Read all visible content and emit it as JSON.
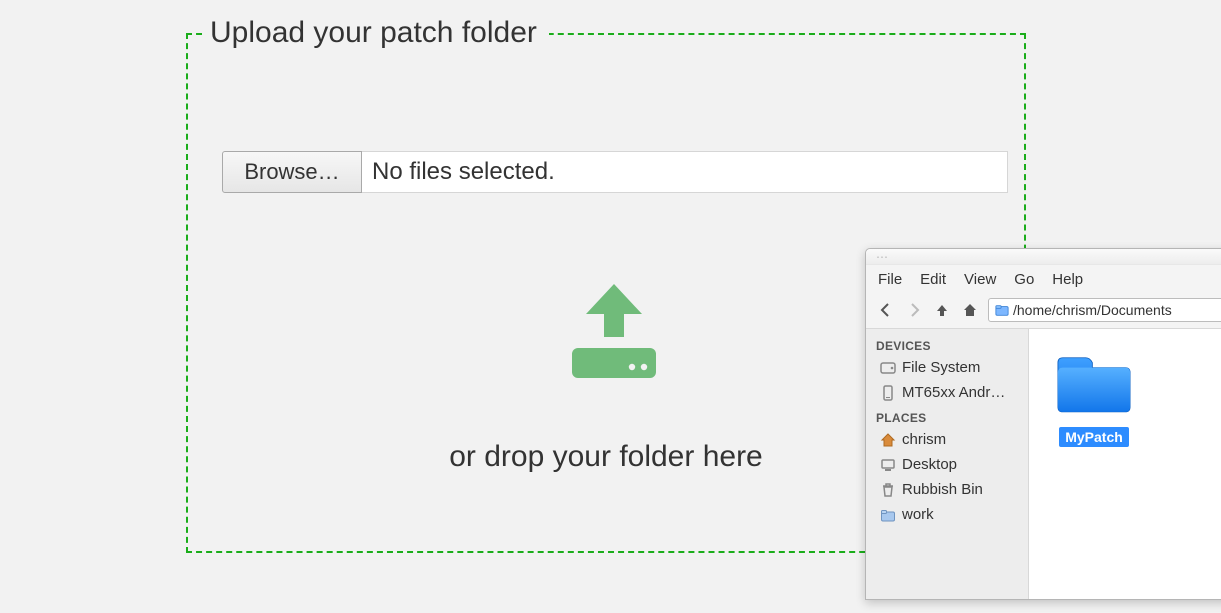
{
  "dropzone": {
    "legend": "Upload your patch folder",
    "browse_label": "Browse…",
    "file_status": "No files selected.",
    "drop_text": "or drop your folder here"
  },
  "file_manager": {
    "menu": {
      "file": "File",
      "edit": "Edit",
      "view": "View",
      "go": "Go",
      "help": "Help"
    },
    "path": "/home/chrism/Documents",
    "sidebar": {
      "devices_heading": "DEVICES",
      "places_heading": "PLACES",
      "devices": {
        "filesystem": "File System",
        "android": "MT65xx Andr…"
      },
      "places": {
        "home": "chrism",
        "desktop": "Desktop",
        "trash": "Rubbish Bin",
        "work": "work"
      }
    },
    "content": {
      "folder_name": "MyPatch"
    }
  }
}
